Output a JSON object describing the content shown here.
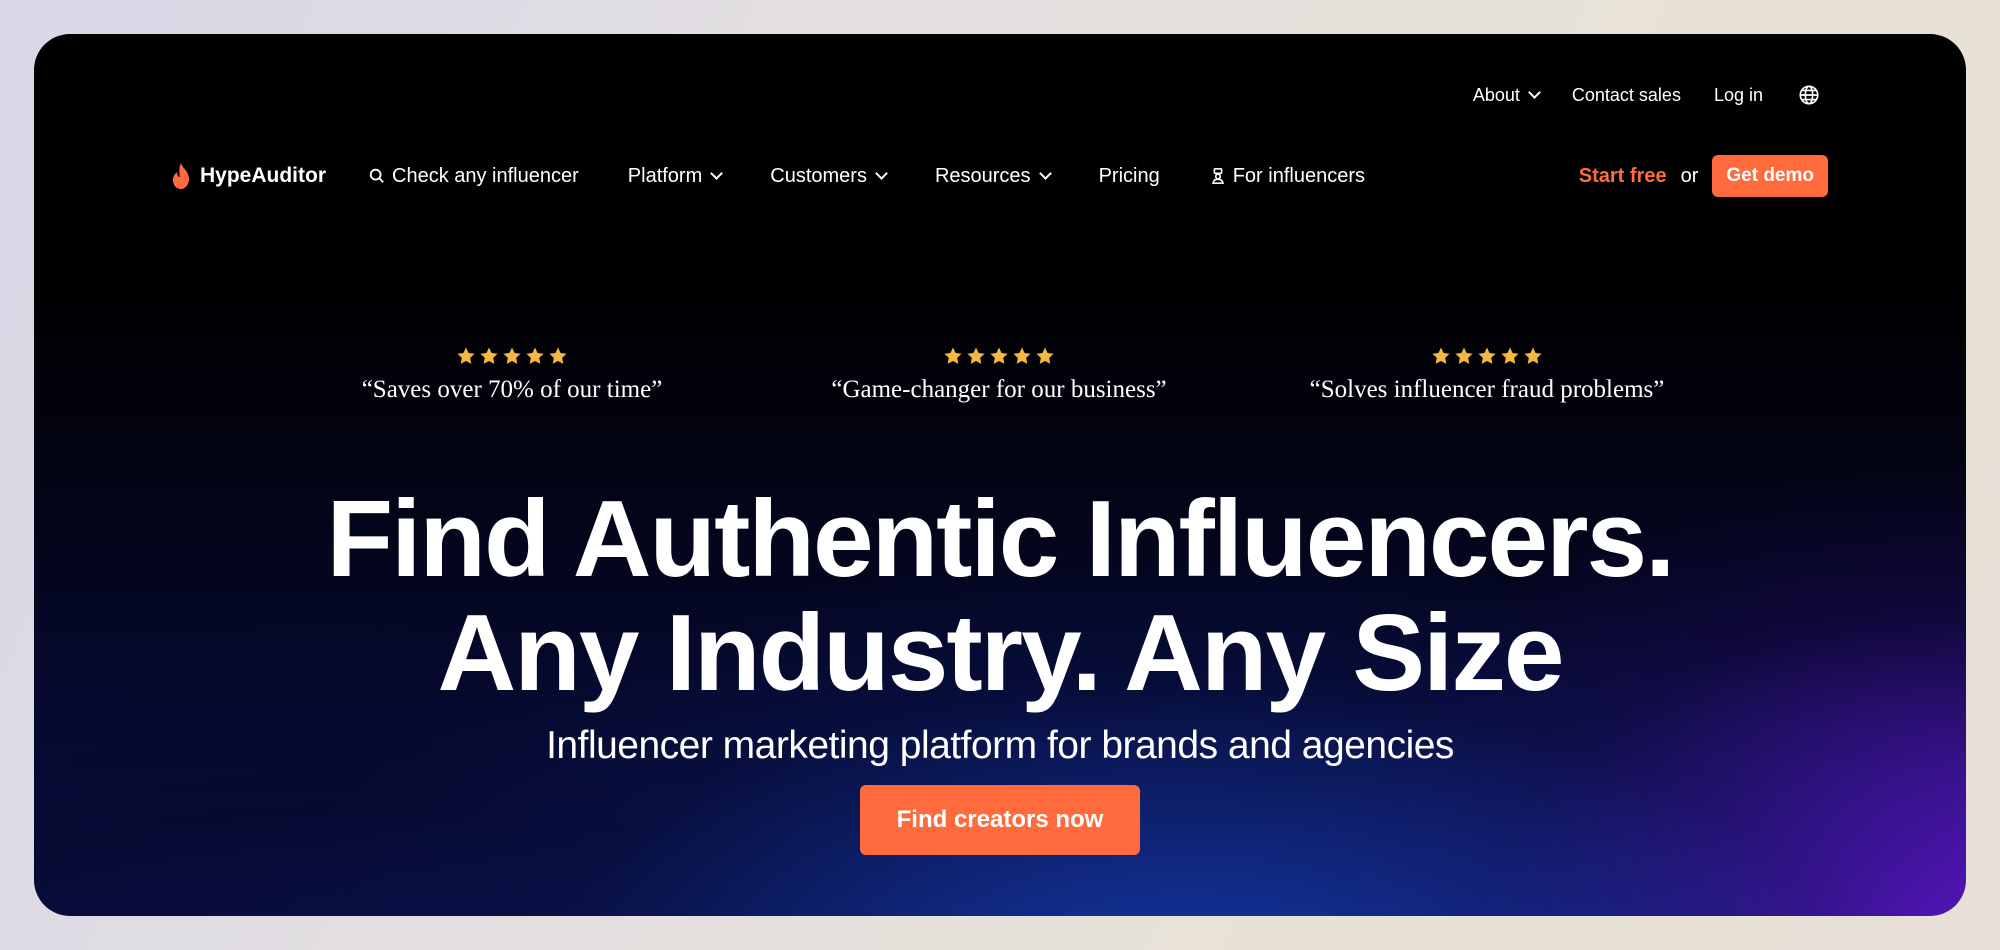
{
  "util_nav": {
    "about": "About",
    "contact_sales": "Contact sales",
    "log_in": "Log in",
    "language_icon": "globe-icon"
  },
  "nav": {
    "logo_text": "HypeAuditor",
    "check_influencer": "Check any influencer",
    "platform": "Platform",
    "customers": "Customers",
    "resources": "Resources",
    "pricing": "Pricing",
    "for_influencers": "For influencers",
    "start_free": "Start free",
    "or": "or",
    "get_demo": "Get demo"
  },
  "testimonials": [
    {
      "rating": 5,
      "quote": "“Saves over 70% of our time”"
    },
    {
      "rating": 5,
      "quote": "“Game-changer for our business”"
    },
    {
      "rating": 5,
      "quote": "“Solves influencer fraud problems”"
    }
  ],
  "hero": {
    "title_line1": "Find Authentic Influencers.",
    "title_line2": "Any Industry. Any Size",
    "subtitle": "Influencer marketing platform for brands and agencies",
    "cta": "Find creators now"
  },
  "colors": {
    "accent": "#ff6b3d",
    "star": "#f5b642",
    "text": "#ffffff"
  }
}
